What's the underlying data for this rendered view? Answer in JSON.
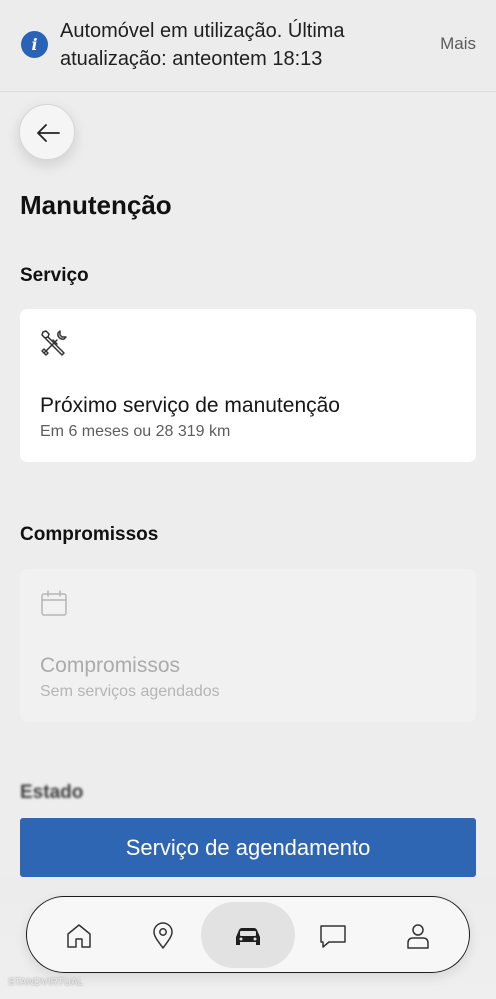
{
  "banner": {
    "icon": "info-icon",
    "message": "Automóvel em utilização. Última atualização: anteontem 18:13",
    "more_label": "Mais",
    "icon_color": "#2a62b5"
  },
  "header": {
    "back_icon": "arrow-left-icon",
    "title": "Manutenção"
  },
  "service_section": {
    "title": "Serviço",
    "card": {
      "icon": "wrench-screwdriver-icon",
      "title": "Próximo serviço de manutenção",
      "subtitle": "Em 6 meses ou 28 319 km"
    }
  },
  "appointments_section": {
    "title": "Compromissos",
    "card": {
      "icon": "calendar-icon",
      "title": "Compromissos",
      "subtitle": "Sem serviços agendados"
    }
  },
  "status_section": {
    "title": "Estado"
  },
  "primary_action": {
    "label": "Serviço de agendamento",
    "color": "#2f66b3"
  },
  "tabbar": {
    "items": [
      {
        "icon": "home-icon",
        "active": false
      },
      {
        "icon": "location-pin-icon",
        "active": false
      },
      {
        "icon": "car-icon",
        "active": true
      },
      {
        "icon": "chat-icon",
        "active": false
      },
      {
        "icon": "profile-icon",
        "active": false
      }
    ]
  },
  "watermark": "STANDVIRTUAL"
}
